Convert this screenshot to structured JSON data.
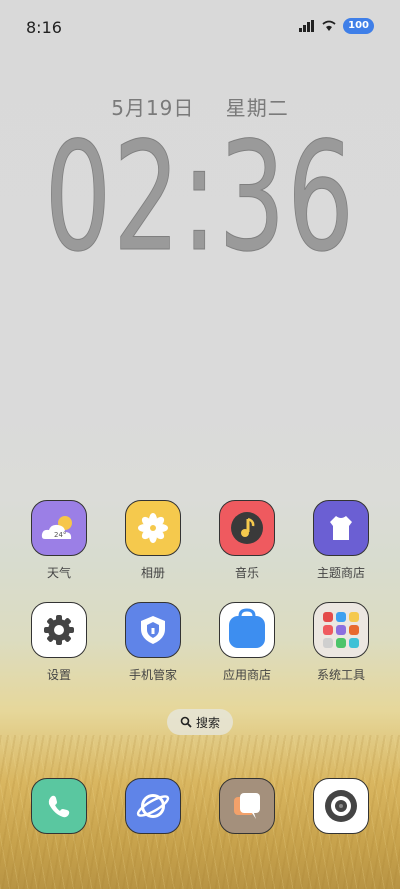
{
  "status": {
    "time": "8:16",
    "battery": "100"
  },
  "lock": {
    "date": "5月19日",
    "weekday": "星期二",
    "clock": "02:36"
  },
  "apps": [
    {
      "label": "天气",
      "icon": "weather-icon",
      "temp": "24°"
    },
    {
      "label": "相册",
      "icon": "gallery-icon"
    },
    {
      "label": "音乐",
      "icon": "music-icon"
    },
    {
      "label": "主题商店",
      "icon": "theme-store-icon"
    },
    {
      "label": "设置",
      "icon": "settings-icon"
    },
    {
      "label": "手机管家",
      "icon": "phone-manager-icon"
    },
    {
      "label": "应用商店",
      "icon": "app-store-icon"
    },
    {
      "label": "系统工具",
      "icon": "system-tools-folder-icon"
    }
  ],
  "search": {
    "label": "搜索"
  },
  "dock": [
    {
      "icon": "phone-icon"
    },
    {
      "icon": "browser-icon"
    },
    {
      "icon": "messages-icon"
    },
    {
      "icon": "camera-icon"
    }
  ],
  "colors": {
    "weather": "#9b7fe6",
    "gallery": "#f5c94d",
    "music": "#ef5a5f",
    "theme": "#6b5fd3",
    "settings": "#ffffff",
    "manager": "#5f84e8",
    "store": "#ffffff",
    "tools": "#ece7e1",
    "phone": "#5ac7a0",
    "browser": "#5f84e8",
    "messages": "#a4907c",
    "camera": "#ffffff"
  }
}
